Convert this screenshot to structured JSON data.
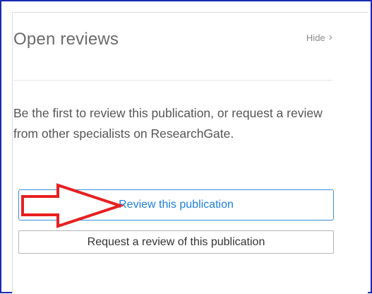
{
  "panel": {
    "title": "Open reviews",
    "hide_label": "Hide",
    "hide_chevron": "›",
    "description": "Be the first to review this publication, or request a review from other specialists on ResearchGate.",
    "primary_button": "Review this publication",
    "secondary_button": "Request a review of this publication"
  },
  "annotation": {
    "arrow_color": "#e81f1f",
    "arrow_fill": "#ffffff"
  },
  "colors": {
    "frame_border": "#1a2bb4",
    "primary_accent": "#3b8de0",
    "text_muted": "#6b6b6b"
  }
}
